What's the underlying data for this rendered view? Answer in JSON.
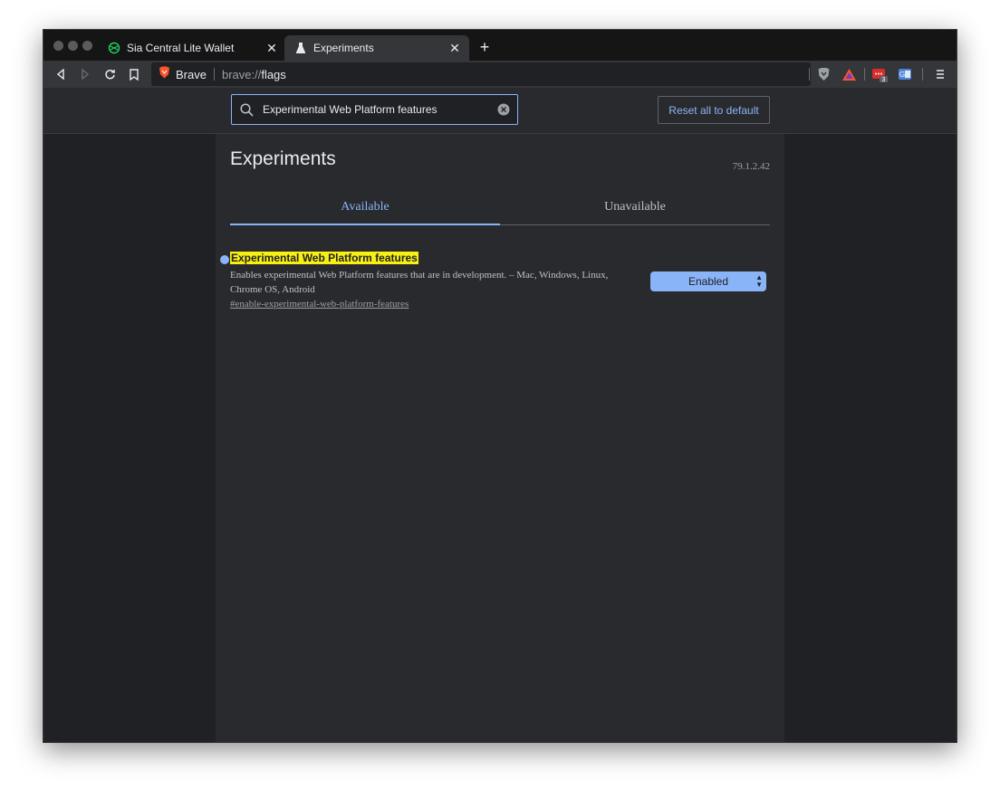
{
  "window": {
    "tabs": [
      {
        "title": "Sia Central Lite Wallet",
        "icon": "sia-icon",
        "active": false
      },
      {
        "title": "Experiments",
        "icon": "flask-icon",
        "active": true
      }
    ],
    "new_tab_label": "+"
  },
  "toolbar": {
    "brand_label": "Brave",
    "url_scheme": "brave://",
    "url_path": "flags",
    "extensions_badge": "3"
  },
  "header": {
    "search_value": "Experimental Web Platform features",
    "reset_label": "Reset all to default"
  },
  "main": {
    "title": "Experiments",
    "version": "79.1.2.42",
    "tabs": [
      {
        "label": "Available",
        "selected": true
      },
      {
        "label": "Unavailable",
        "selected": false
      }
    ],
    "flags": [
      {
        "title": "Experimental Web Platform features",
        "description": "Enables experimental Web Platform features that are in development. – Mac, Windows, Linux, Chrome OS, Android",
        "link": "#enable-experimental-web-platform-features",
        "value": "Enabled"
      }
    ]
  },
  "colors": {
    "accent": "#8ab4f8",
    "highlight": "#f8f012",
    "background": "#202124",
    "panel": "#292a2d"
  }
}
